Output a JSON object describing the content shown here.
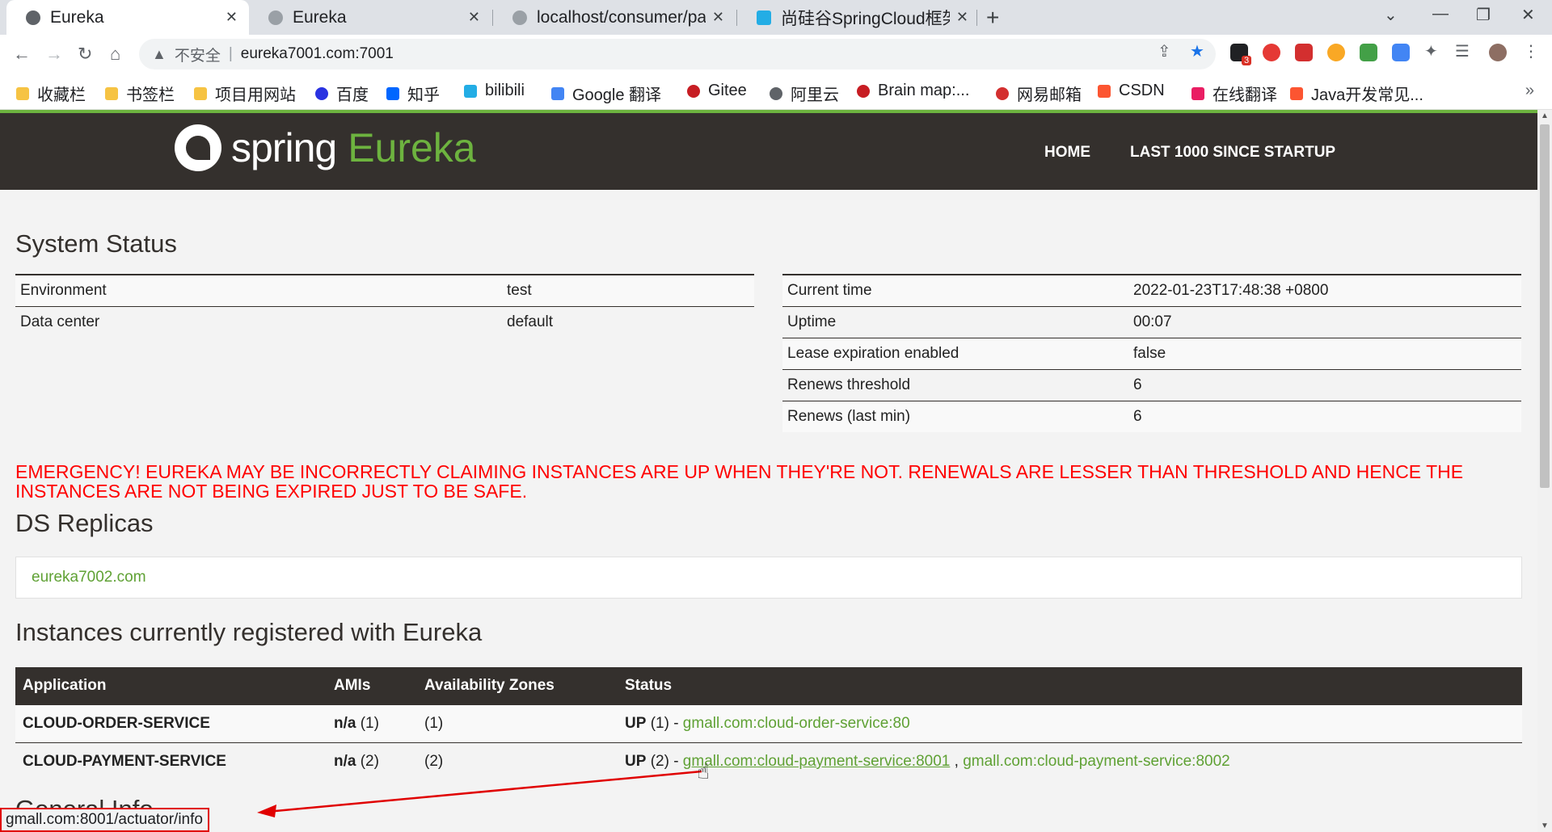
{
  "browser": {
    "tabs": [
      {
        "title": "Eureka",
        "active": true
      },
      {
        "title": "Eureka",
        "active": false
      },
      {
        "title": "localhost/consumer/pa",
        "active": false
      },
      {
        "title": "尚硅谷SpringCloud框架",
        "active": false
      }
    ],
    "address": {
      "insecure_label": "不安全",
      "url": "eureka7001.com:7001"
    },
    "extension_badge": "3",
    "bookmarks": [
      "收藏栏",
      "书签栏",
      "项目用网站",
      "百度",
      "知乎",
      "bilibili",
      "Google 翻译",
      "Gitee",
      "阿里云",
      "Brain map:...",
      "网易邮箱",
      "CSDN",
      "在线翻译",
      "Java开发常见..."
    ],
    "status_url": "gmall.com:8001/actuator/info"
  },
  "header": {
    "logo_spring": "spring",
    "logo_eureka": "Eureka",
    "nav": {
      "home": "HOME",
      "last1000": "LAST 1000 SINCE STARTUP"
    }
  },
  "system_status": {
    "title": "System Status",
    "left": [
      {
        "label": "Environment",
        "value": "test"
      },
      {
        "label": "Data center",
        "value": "default"
      }
    ],
    "right": [
      {
        "label": "Current time",
        "value": "2022-01-23T17:48:38 +0800"
      },
      {
        "label": "Uptime",
        "value": "00:07"
      },
      {
        "label": "Lease expiration enabled",
        "value": "false"
      },
      {
        "label": "Renews threshold",
        "value": "6"
      },
      {
        "label": "Renews (last min)",
        "value": "6"
      }
    ]
  },
  "emergency": "EMERGENCY! EUREKA MAY BE INCORRECTLY CLAIMING INSTANCES ARE UP WHEN THEY'RE NOT. RENEWALS ARE LESSER THAN THRESHOLD AND HENCE THE INSTANCES ARE NOT BEING EXPIRED JUST TO BE SAFE.",
  "ds_replicas": {
    "title": "DS Replicas",
    "replica": "eureka7002.com"
  },
  "instances": {
    "title": "Instances currently registered with Eureka",
    "columns": [
      "Application",
      "AMIs",
      "Availability Zones",
      "Status"
    ],
    "rows": [
      {
        "application": "CLOUD-ORDER-SERVICE",
        "amis_label": "n/a",
        "amis_count": "(1)",
        "zones": "(1)",
        "status_label": "UP",
        "status_count": "(1) -",
        "links": [
          "gmall.com:cloud-order-service:80"
        ]
      },
      {
        "application": "CLOUD-PAYMENT-SERVICE",
        "amis_label": "n/a",
        "amis_count": "(2)",
        "zones": "(2)",
        "status_label": "UP",
        "status_count": "(2) -",
        "links": [
          "gmall.com:cloud-payment-service:8001",
          "gmall.com:cloud-payment-service:8002"
        ],
        "link_separator": ","
      }
    ]
  },
  "next_section_peek": "General Info",
  "colors": {
    "brand_dark": "#34302d",
    "brand_green": "#6db33f",
    "link_green": "#5fa134",
    "emergency_red": "#ff0000",
    "annotation_red": "#e00000"
  }
}
